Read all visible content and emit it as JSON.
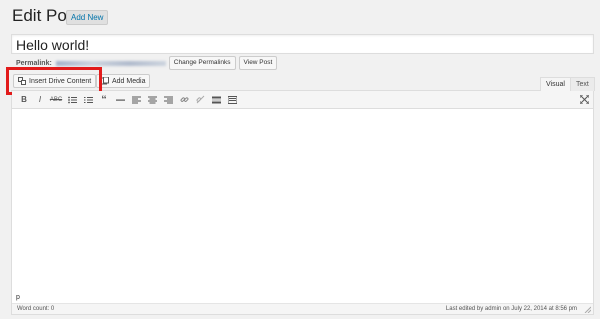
{
  "header": {
    "title": "Edit Post",
    "add_new_label": "Add New"
  },
  "post": {
    "title_value": "Hello world!"
  },
  "permalink": {
    "label": "Permalink:",
    "change_label": "Change Permalinks",
    "view_label": "View Post"
  },
  "media_buttons": {
    "insert_drive_label": "Insert Drive Content",
    "add_media_label": "Add Media"
  },
  "editor_tabs": {
    "visual": "Visual",
    "text": "Text",
    "active": "Visual"
  },
  "toolbar": {
    "buttons": [
      "bold",
      "italic",
      "strikethrough",
      "bullet-list",
      "numbered-list",
      "blockquote",
      "horizontal-rule",
      "align-left",
      "align-center",
      "align-right",
      "insert-link",
      "remove-link",
      "read-more",
      "toolbar-toggle",
      "fullscreen"
    ]
  },
  "editor": {
    "path": "p"
  },
  "status": {
    "word_count": "Word count: 0",
    "last_edited": "Last edited by admin on July 22, 2014 at 8:56 pm"
  },
  "colors": {
    "highlight": "#e21b1b",
    "link": "#0073aa"
  }
}
